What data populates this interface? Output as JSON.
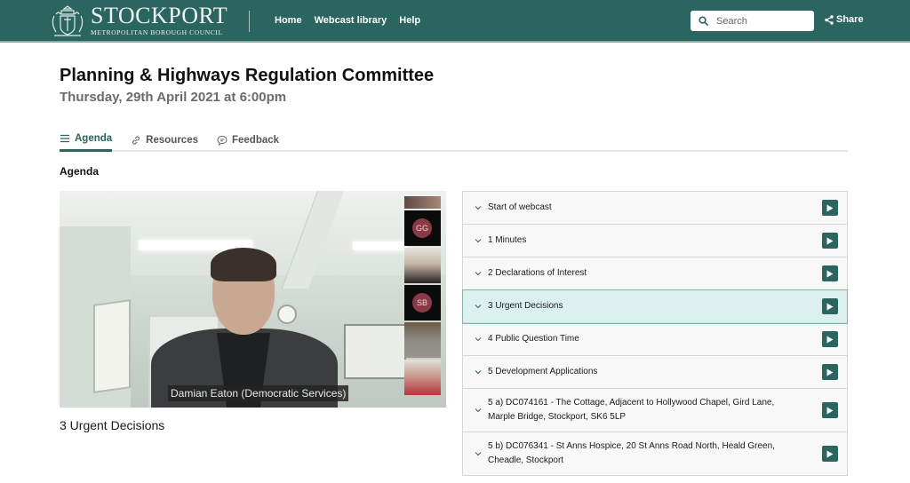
{
  "header": {
    "brand_name": "STOCKPORT",
    "brand_sub": "METROPOLITAN BOROUGH COUNCIL",
    "nav": [
      "Home",
      "Webcast library",
      "Help"
    ],
    "search_placeholder": "Search",
    "share_label": "Share"
  },
  "meeting": {
    "title": "Planning & Highways Regulation Committee",
    "datetime": "Thursday, 29th April 2021 at 6:00pm"
  },
  "tabs": [
    {
      "label": "Agenda",
      "icon": "list-icon",
      "active": true
    },
    {
      "label": "Resources",
      "icon": "link-icon",
      "active": false
    },
    {
      "label": "Feedback",
      "icon": "comment-icon",
      "active": false
    }
  ],
  "section_heading": "Agenda",
  "video": {
    "speaker_label": "Damian Eaton (Democratic Services)",
    "participants": [
      {
        "type": "video"
      },
      {
        "type": "avatar",
        "initials": "GG"
      },
      {
        "type": "video"
      },
      {
        "type": "avatar",
        "initials": "SB"
      },
      {
        "type": "video"
      },
      {
        "type": "video"
      }
    ],
    "current_item_caption": "3 Urgent Decisions"
  },
  "agenda_items": [
    {
      "label": "Start of webcast",
      "active": false
    },
    {
      "label": "1 Minutes",
      "active": false
    },
    {
      "label": "2 Declarations of Interest",
      "active": false
    },
    {
      "label": "3 Urgent Decisions",
      "active": true
    },
    {
      "label": "4 Public Question Time",
      "active": false
    },
    {
      "label": "5 Development Applications",
      "active": false
    },
    {
      "label": "5 a) DC074161 - The Cottage, Adjacent to Hollywood Chapel, Gird Lane, Marple Bridge, Stockport, SK6 5LP",
      "active": false
    },
    {
      "label": "5 b) DC076341 - St Anns Hospice, 20 St Anns Road North, Heald Green, Cheadle, Stockport",
      "active": false
    }
  ],
  "colors": {
    "brand": "#2a6560",
    "active_item_bg": "#dcf0ef",
    "avatar": "#8a3a46"
  }
}
